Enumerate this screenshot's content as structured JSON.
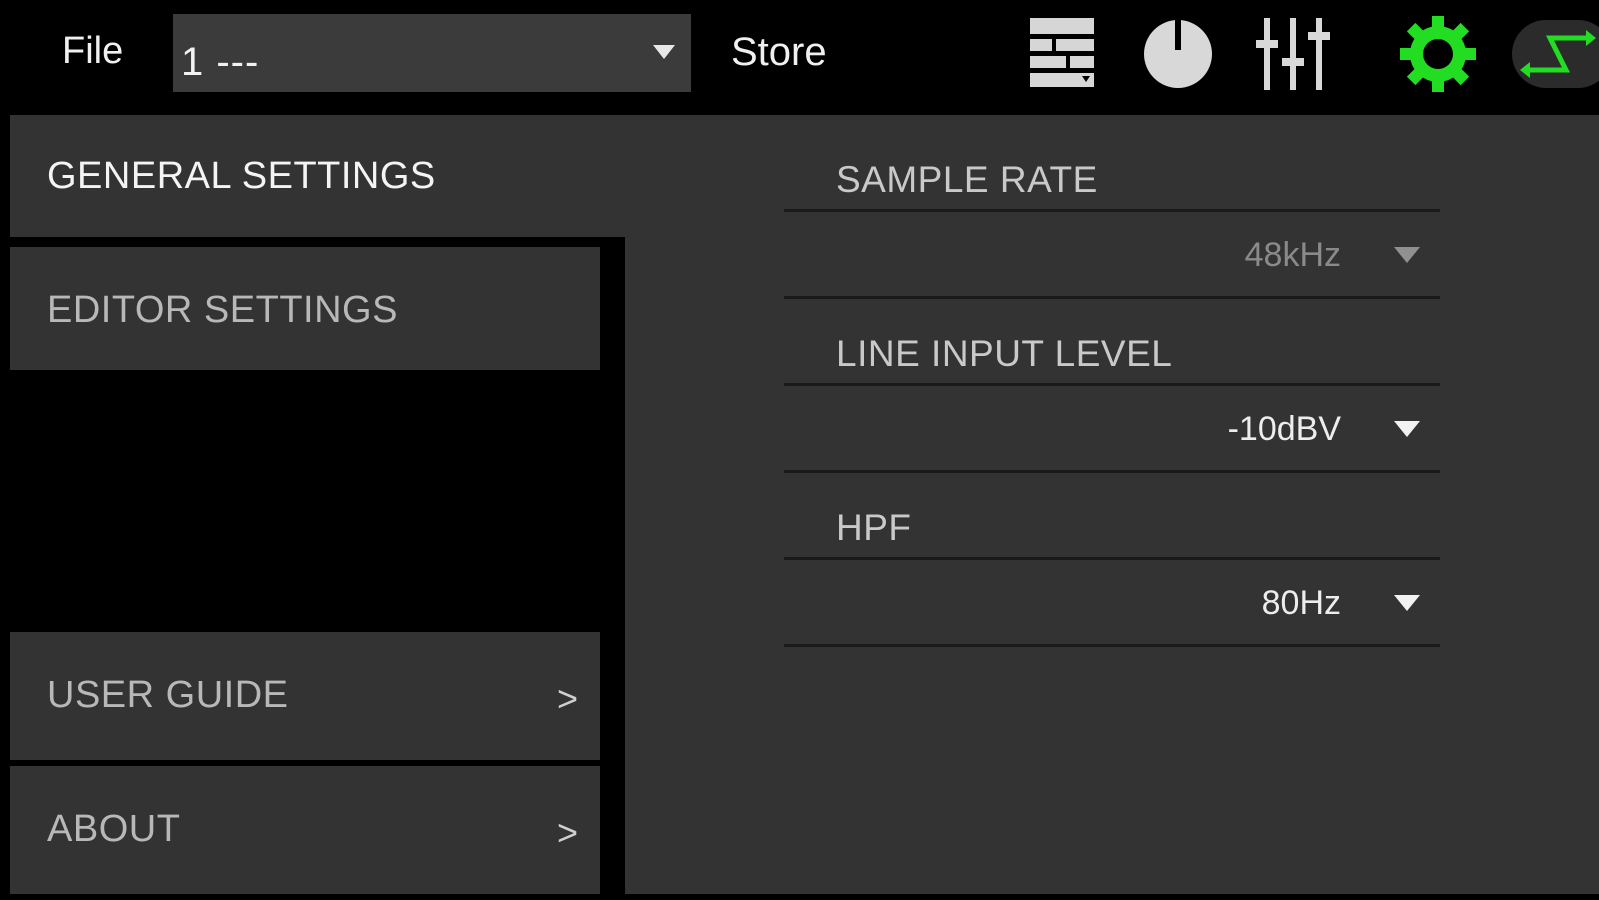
{
  "toolbar": {
    "file_label": "File",
    "preset_value": "1  ---",
    "store_label": "Store",
    "icons": [
      "scenes-icon",
      "knob-icon",
      "faders-icon",
      "gear-icon",
      "connection-icon"
    ],
    "accent_color": "#22dd22"
  },
  "menu": {
    "general": "GENERAL SETTINGS",
    "editor": "EDITOR SETTINGS",
    "guide": "USER GUIDE",
    "about": "ABOUT",
    "chevron": ">"
  },
  "settings": [
    {
      "label": "SAMPLE RATE",
      "value": "48kHz"
    },
    {
      "label": "LINE INPUT LEVEL",
      "value": "-10dBV"
    },
    {
      "label": "HPF",
      "value": "80Hz"
    }
  ]
}
